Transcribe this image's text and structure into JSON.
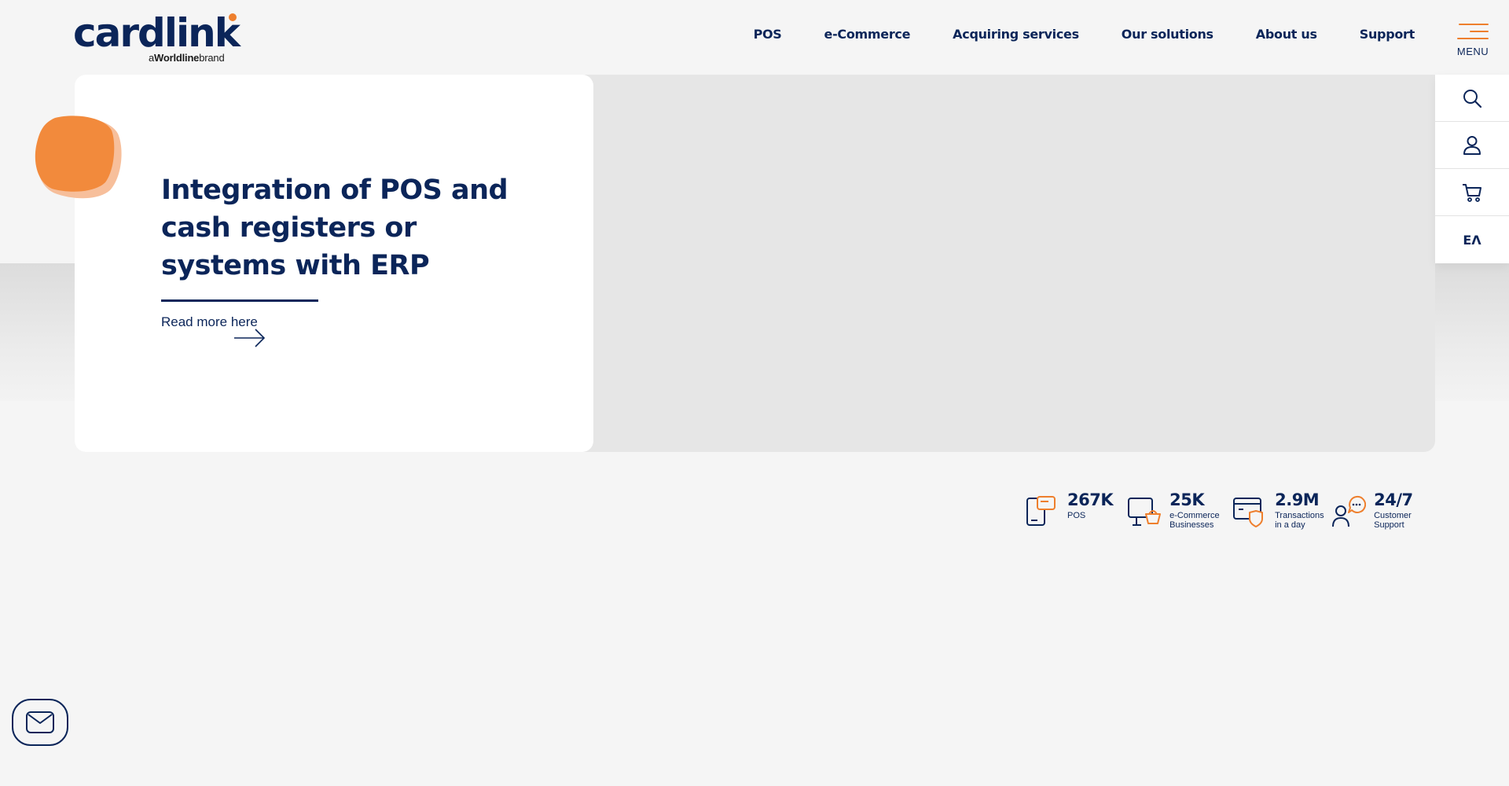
{
  "brand": {
    "name": "cardlink",
    "tagline_prefix": "a",
    "tagline_brand": "Worldline",
    "tagline_suffix": "brand",
    "accent_color": "#ee7f2d",
    "primary_color": "#0b2559"
  },
  "nav": {
    "items": [
      {
        "label": "POS"
      },
      {
        "label": "e-Commerce"
      },
      {
        "label": "Acquiring services"
      },
      {
        "label": "Our solutions"
      },
      {
        "label": "About us"
      },
      {
        "label": "Support"
      }
    ],
    "menu_label": "MENU"
  },
  "rail": {
    "items": [
      {
        "icon": "search-icon"
      },
      {
        "icon": "user-icon"
      },
      {
        "icon": "cart-icon"
      }
    ],
    "language": "ΕΛ"
  },
  "hero": {
    "title": "Integration of POS and cash registers or systems with ERP",
    "read_more": "Read more here"
  },
  "stats": [
    {
      "value": "267K",
      "label": "POS",
      "icon": "pos-terminal-icon"
    },
    {
      "value": "25K",
      "label": "e-Commerce Businesses",
      "icon": "ecommerce-icon"
    },
    {
      "value": "2.9M",
      "label": "Transactions in a day",
      "icon": "secure-card-icon"
    },
    {
      "value": "24/7",
      "label": "Customer Support",
      "icon": "support-icon"
    }
  ],
  "contact": {
    "icon": "mail-icon"
  }
}
